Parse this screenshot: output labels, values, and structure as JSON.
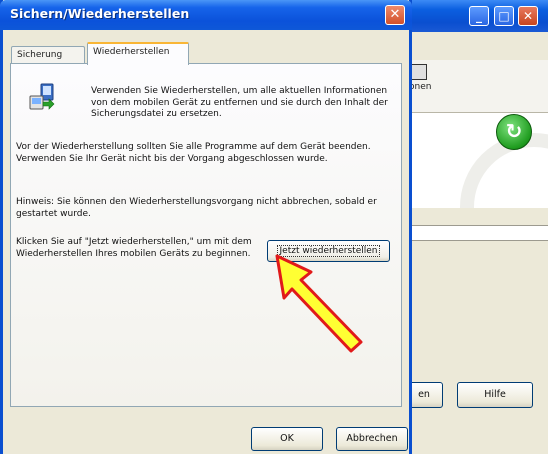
{
  "dialog": {
    "title": "Sichern/Wiederherstellen",
    "close_glyph": "✕",
    "tabs": [
      {
        "label": "Sicherung",
        "selected": false
      },
      {
        "label": "Wiederherstellen",
        "selected": true
      }
    ],
    "intro_text": "Verwenden Sie Wiederherstellen, um alle aktuellen Informationen von dem mobilen Gerät zu entfernen und sie durch den Inhalt der Sicherungsdatei zu ersetzen.",
    "paragraph_1": "Vor der Wiederherstellung sollten Sie alle Programme auf dem Gerät beenden. Verwenden Sie Ihr Gerät nicht bis der Vorgang abgeschlossen wurde.",
    "paragraph_2": "Hinweis: Sie können den Wiederherstellungsvorgang nicht abbrechen, sobald er gestartet wurde.",
    "paragraph_3": "Klicken Sie auf \"Jetzt wiederherstellen,\" um mit dem Wiederherstellen Ihres mobilen Geräts zu beginnen.",
    "restore_button": "Jetzt wiederherstellen",
    "ok_button": "OK",
    "cancel_button": "Abbrechen"
  },
  "background_window": {
    "minimize_glyph": "_",
    "maximize_glyph": "□",
    "close_glyph": "✕",
    "icon_label": "onen",
    "refresh_glyph": "↻",
    "button_1": "en",
    "button_2": "Hilfe"
  },
  "colors": {
    "titlebar_blue": "#0b52da",
    "close_red": "#d2502a",
    "arrow_yellow": "#ffff33",
    "arrow_red": "#e11a1a",
    "refresh_green": "#1f9c1f"
  }
}
